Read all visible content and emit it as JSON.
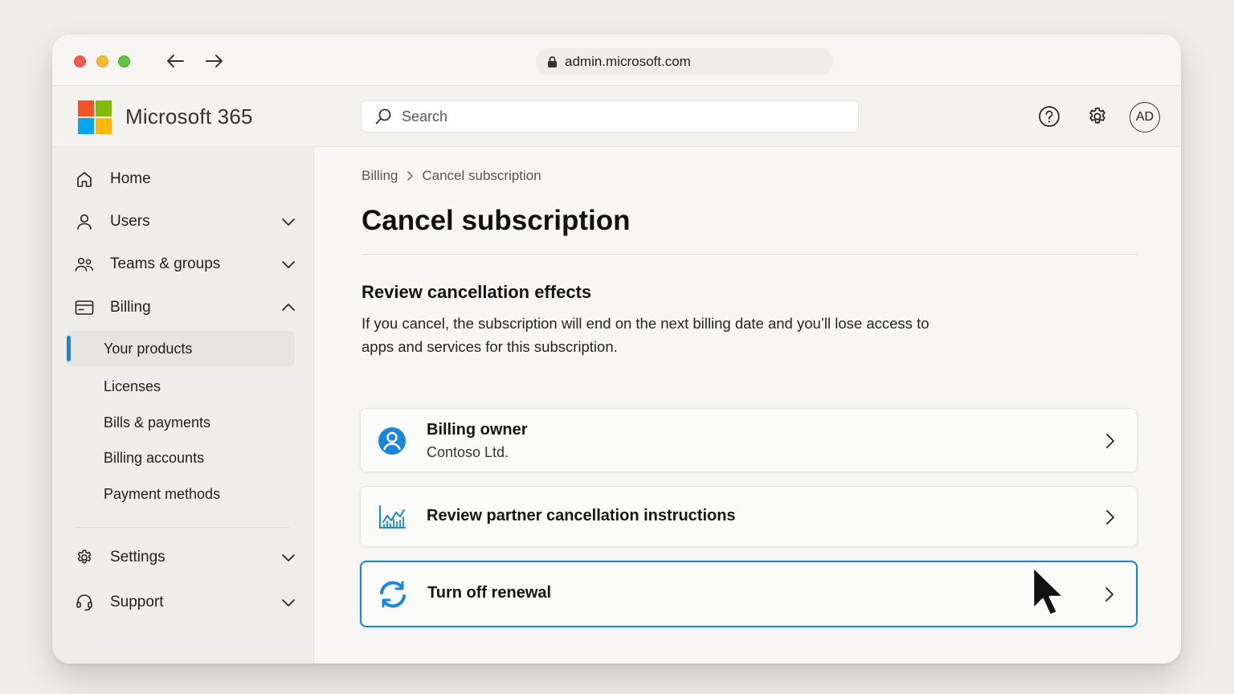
{
  "browser": {
    "url": "admin.microsoft.com"
  },
  "app": {
    "brand": "Microsoft 365",
    "search_placeholder": "Search",
    "avatar_initials": "AD",
    "logo_colors": [
      "#f35325",
      "#81bc06",
      "#05a6f0",
      "#ffba08"
    ]
  },
  "sidebar": {
    "home": "Home",
    "users": "Users",
    "teams_groups": "Teams & groups",
    "billing": "Billing",
    "billing_sub": {
      "your_products": "Your products",
      "licenses": "Licenses",
      "bills_payments": "Bills & payments",
      "billing_accounts": "Billing accounts",
      "payment_methods": "Payment methods"
    },
    "settings": "Settings",
    "support": "Support"
  },
  "main": {
    "breadcrumb": {
      "parent": "Billing",
      "current": "Cancel subscription"
    },
    "title": "Cancel subscription",
    "section_title": "Review cancellation effects",
    "section_description": "If you cancel, the subscription will end on the next billing date and you’ll lose access to apps and services for this subscription.",
    "cards": {
      "billing_owner": {
        "title": "Billing owner",
        "subtitle": "Contoso Ltd."
      },
      "partner_instructions": {
        "title": "Review partner cancellation instructions"
      },
      "turn_off_renewal": {
        "title": "Turn off renewal"
      }
    }
  },
  "colors": {
    "accent": "#1a86d9",
    "active_nav_bg": "#e6e4df"
  }
}
